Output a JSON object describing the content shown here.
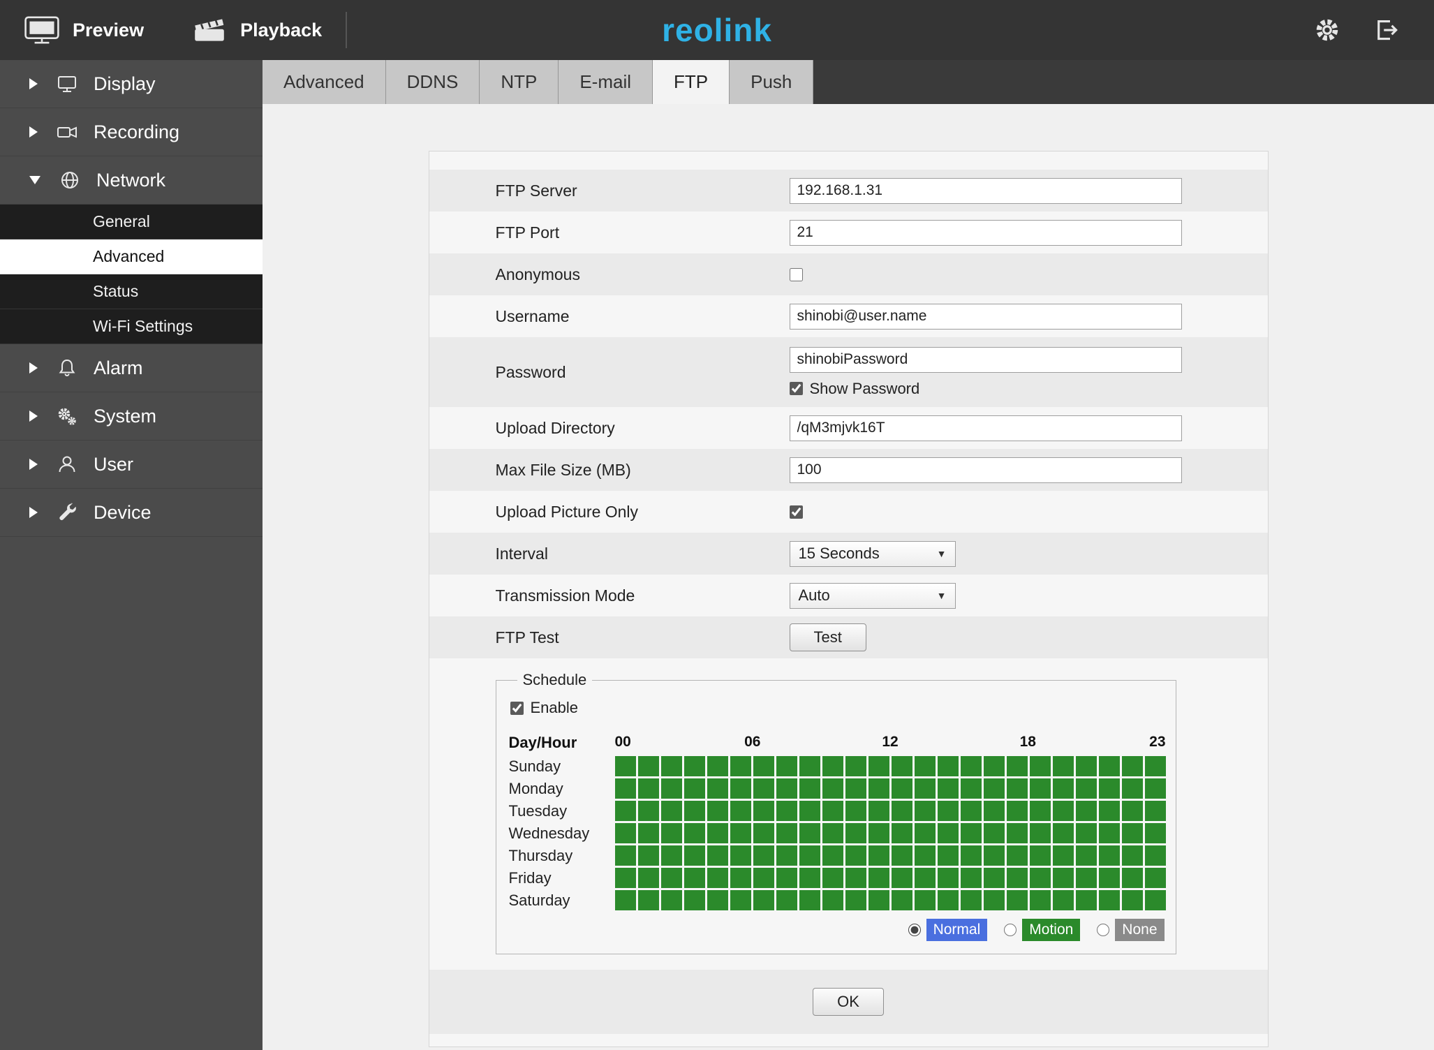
{
  "topbar": {
    "preview_label": "Preview",
    "playback_label": "Playback",
    "logo_text": "reolink",
    "logo_color": "#2fb2e6"
  },
  "sidebar": {
    "items": [
      {
        "label": "Display"
      },
      {
        "label": "Recording"
      },
      {
        "label": "Network",
        "expanded": true
      },
      {
        "label": "Alarm"
      },
      {
        "label": "System"
      },
      {
        "label": "User"
      },
      {
        "label": "Device"
      }
    ],
    "network_children": [
      {
        "label": "General",
        "selected": false
      },
      {
        "label": "Advanced",
        "selected": true
      },
      {
        "label": "Status",
        "selected": false
      },
      {
        "label": "Wi-Fi Settings",
        "selected": false
      }
    ]
  },
  "tabs": {
    "items": [
      {
        "label": "Advanced",
        "active": false
      },
      {
        "label": "DDNS",
        "active": false
      },
      {
        "label": "NTP",
        "active": false
      },
      {
        "label": "E-mail",
        "active": false
      },
      {
        "label": "FTP",
        "active": true
      },
      {
        "label": "Push",
        "active": false
      }
    ]
  },
  "form": {
    "ftp_server": {
      "label": "FTP Server",
      "value": "192.168.1.31"
    },
    "ftp_port": {
      "label": "FTP Port",
      "value": "21"
    },
    "anonymous": {
      "label": "Anonymous",
      "checked": false
    },
    "username": {
      "label": "Username",
      "value": "shinobi@user.name"
    },
    "password": {
      "label": "Password",
      "value": "shinobiPassword",
      "show_password_label": "Show Password",
      "show_password_checked": true
    },
    "upload_directory": {
      "label": "Upload Directory",
      "value": "/qM3mjvk16T"
    },
    "max_file_size": {
      "label": "Max File Size (MB)",
      "value": "100"
    },
    "upload_picture_only": {
      "label": "Upload Picture Only",
      "checked": true
    },
    "interval": {
      "label": "Interval",
      "value": "15 Seconds"
    },
    "transmission_mode": {
      "label": "Transmission Mode",
      "value": "Auto"
    },
    "ftp_test": {
      "label": "FTP Test",
      "button_label": "Test"
    }
  },
  "schedule": {
    "legend": "Schedule",
    "enable_label": "Enable",
    "enable_checked": true,
    "day_hour_label": "Day/Hour",
    "hour_labels": [
      "00",
      "06",
      "12",
      "18",
      "23"
    ],
    "days": [
      "Sunday",
      "Monday",
      "Tuesday",
      "Wednesday",
      "Thursday",
      "Friday",
      "Saturday"
    ],
    "columns": 24,
    "all_cells_state": "motion",
    "cell_color": "#2b8a2b",
    "modes": [
      {
        "label": "Normal",
        "color": "#4a6fdf",
        "selected": true
      },
      {
        "label": "Motion",
        "color": "#2b8a2b",
        "selected": false
      },
      {
        "label": "None",
        "color": "#8a8a8a",
        "selected": false
      }
    ]
  },
  "ok_label": "OK"
}
